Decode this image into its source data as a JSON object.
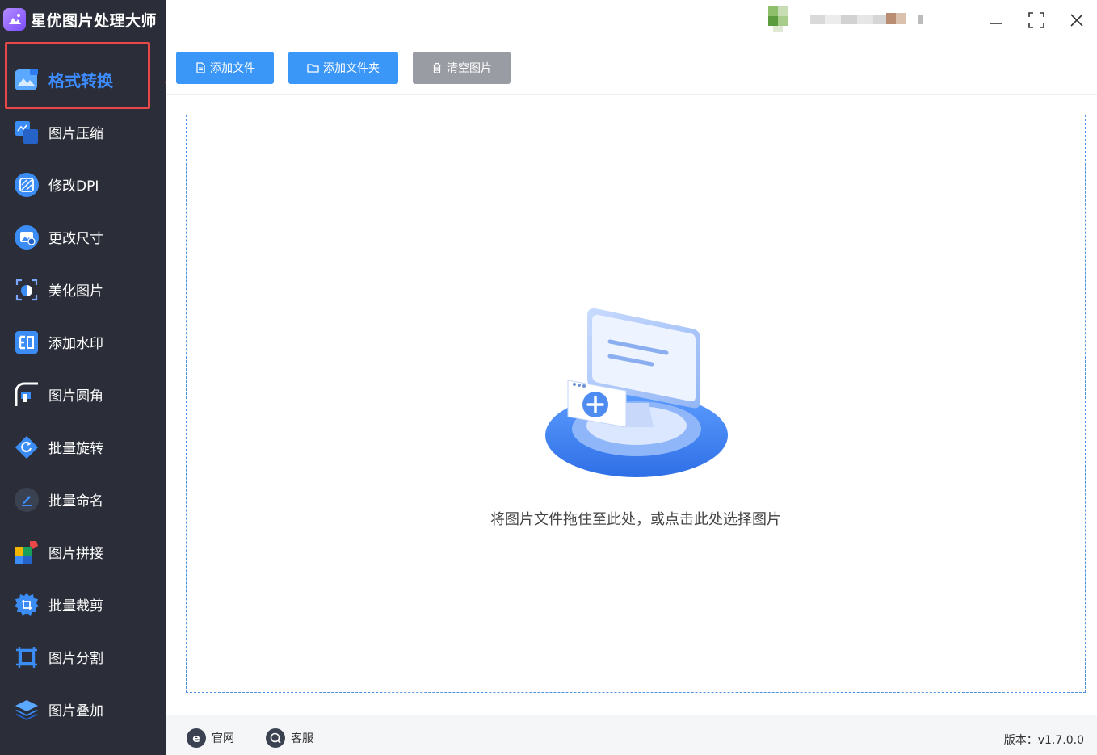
{
  "app": {
    "title": "星优图片处理大师"
  },
  "sidebar": {
    "items": [
      {
        "label": "格式转换",
        "icon": "format-convert-icon",
        "active": true
      },
      {
        "label": "图片压缩",
        "icon": "compress-icon"
      },
      {
        "label": "修改DPI",
        "icon": "dpi-icon"
      },
      {
        "label": "更改尺寸",
        "icon": "resize-icon"
      },
      {
        "label": "美化图片",
        "icon": "beautify-icon"
      },
      {
        "label": "添加水印",
        "icon": "watermark-icon"
      },
      {
        "label": "图片圆角",
        "icon": "rounded-corner-icon"
      },
      {
        "label": "批量旋转",
        "icon": "rotate-icon"
      },
      {
        "label": "批量命名",
        "icon": "rename-icon"
      },
      {
        "label": "图片拼接",
        "icon": "stitch-icon"
      },
      {
        "label": "批量裁剪",
        "icon": "crop-icon"
      },
      {
        "label": "图片分割",
        "icon": "split-icon"
      },
      {
        "label": "图片叠加",
        "icon": "overlay-icon"
      }
    ]
  },
  "toolbar": {
    "add_file": "添加文件",
    "add_folder": "添加文件夹",
    "clear": "清空图片"
  },
  "dropzone": {
    "text": "将图片文件拖住至此处，或点击此处选择图片"
  },
  "footer": {
    "website": "官网",
    "support": "客服",
    "version": "版本：v1.7.0.0"
  },
  "colors": {
    "accent": "#3a96f7",
    "sidebar_bg": "#2b2e38",
    "highlight": "#e84848"
  }
}
